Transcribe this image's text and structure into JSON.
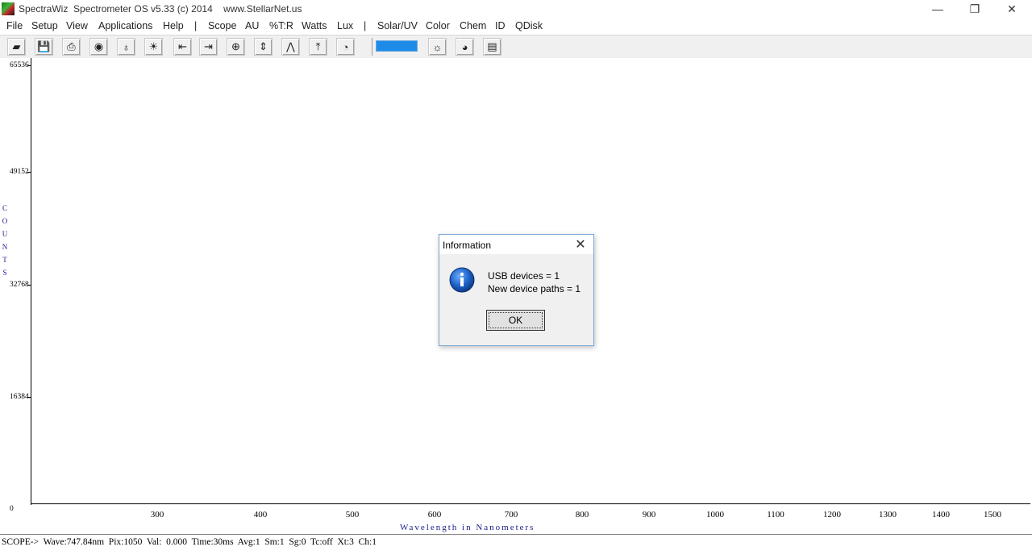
{
  "window": {
    "title": "SpectraWiz  Spectrometer OS v5.33 (c) 2014    www.StellarNet.us",
    "minimize_glyph": "—",
    "maximize_glyph": "❐",
    "close_glyph": "✕"
  },
  "menu": [
    {
      "label": "File"
    },
    {
      "label": "Setup"
    },
    {
      "label": "View"
    },
    {
      "label": "Applications"
    },
    {
      "label": "Help"
    },
    {
      "label": "|"
    },
    {
      "label": "Scope"
    },
    {
      "label": "AU"
    },
    {
      "label": "%T:R"
    },
    {
      "label": "Watts"
    },
    {
      "label": "Lux"
    },
    {
      "label": "|"
    },
    {
      "label": "Solar/UV"
    },
    {
      "label": "Color"
    },
    {
      "label": "Chem"
    },
    {
      "label": "ID"
    },
    {
      "label": "QDisk"
    }
  ],
  "toolbar": {
    "buttons": [
      {
        "icon": "open-folder-icon",
        "glyph": "▰"
      },
      {
        "icon": "save-icon",
        "glyph": "💾"
      },
      {
        "icon": "print-icon",
        "glyph": "⎙"
      },
      {
        "icon": "camera-icon",
        "glyph": "◉"
      },
      {
        "icon": "lamp-dark-icon",
        "glyph": "♁"
      },
      {
        "icon": "lamp-light-icon",
        "glyph": "☀"
      },
      {
        "icon": "scroll-left-icon",
        "glyph": "⇤"
      },
      {
        "icon": "scroll-right-icon",
        "glyph": "⇥"
      },
      {
        "icon": "zoom-icon",
        "glyph": "⊕"
      },
      {
        "icon": "autoscale-icon",
        "glyph": "⇕"
      },
      {
        "icon": "peak-icon",
        "glyph": "⋀"
      },
      {
        "icon": "expand-y-icon",
        "glyph": "⤒"
      },
      {
        "icon": "timer-icon",
        "glyph": "◔"
      },
      {
        "icon": "sun-icon",
        "glyph": "☼"
      },
      {
        "icon": "color-wheel-icon",
        "glyph": "◕"
      },
      {
        "icon": "chart-icon",
        "glyph": "▤"
      }
    ]
  },
  "plot": {
    "y_ticks": [
      "65536",
      "49152",
      "32768",
      "16384",
      "0"
    ],
    "x_ticks": [
      "300",
      "400",
      "500",
      "600",
      "700",
      "800",
      "900",
      "1000",
      "1100",
      "1200",
      "1300",
      "1400",
      "1500"
    ],
    "y_label": [
      "C",
      "O",
      "U",
      "N",
      "T",
      "S"
    ],
    "x_label": "Wavelength in Nanometers"
  },
  "status": {
    "text": "SCOPE->  Wave:747.84nm  Pix:1050  Val:  0.000  Time:30ms  Avg:1  Sm:1  Sg:0  Tc:off  Xt:3  Ch:1"
  },
  "dialog": {
    "title": "Information",
    "line1": "USB devices = 1",
    "line2": "New device paths = 1",
    "ok_label": "OK",
    "close_glyph": "✕"
  }
}
